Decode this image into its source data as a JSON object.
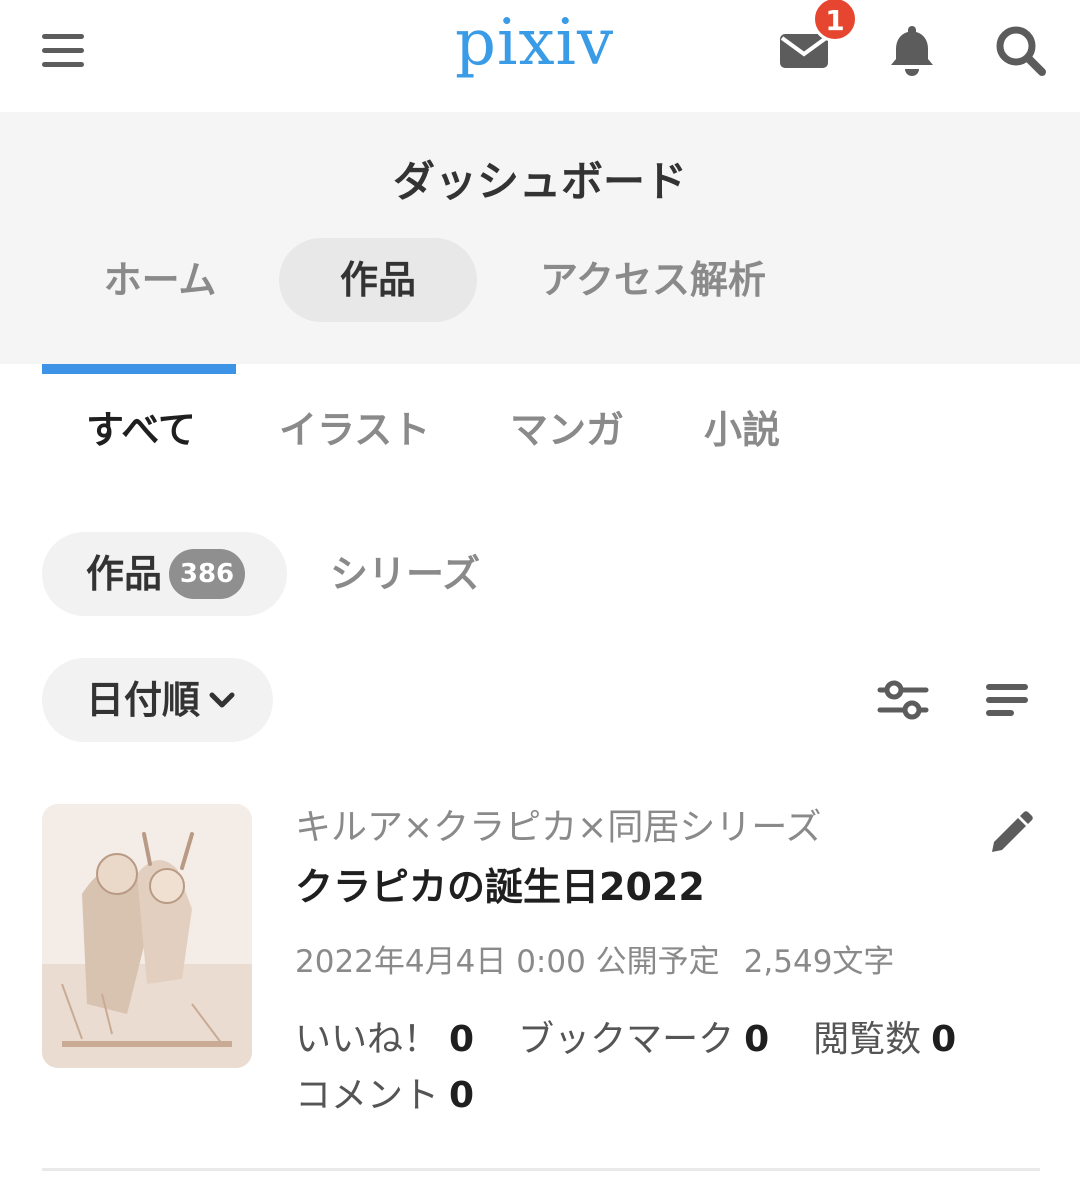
{
  "header": {
    "logo_text": "pixiv",
    "notification_count": "1",
    "icons": [
      "hamburger-menu-icon",
      "mail-icon",
      "bell-icon",
      "search-icon"
    ],
    "accent_color": "#3d93e6",
    "badge_color": "#e6452f"
  },
  "dashboard": {
    "title": "ダッシュボード",
    "tabs": [
      {
        "label": "ホーム",
        "active": false
      },
      {
        "label": "作品",
        "active": true
      },
      {
        "label": "アクセス解析",
        "active": false
      }
    ]
  },
  "categories": [
    {
      "label": "すべて",
      "active": true
    },
    {
      "label": "イラスト",
      "active": false
    },
    {
      "label": "マンガ",
      "active": false
    },
    {
      "label": "小説",
      "active": false
    }
  ],
  "view_toggle": {
    "works_label": "作品",
    "works_count": "386",
    "series_label": "シリーズ"
  },
  "sort": {
    "label": "日付順"
  },
  "work": {
    "series": "キルア×クラピカ×同居シリーズ",
    "title": "クラピカの誕生日2022",
    "schedule": "2022年4月4日 0:00 公開予定",
    "characters": "2,549文字",
    "stats": {
      "likes_label": "いいね！",
      "likes": "0",
      "bookmarks_label": "ブックマーク",
      "bookmarks": "0",
      "views_label": "閲覧数",
      "views": "0",
      "comments_label": "コメント",
      "comments": "0"
    }
  }
}
